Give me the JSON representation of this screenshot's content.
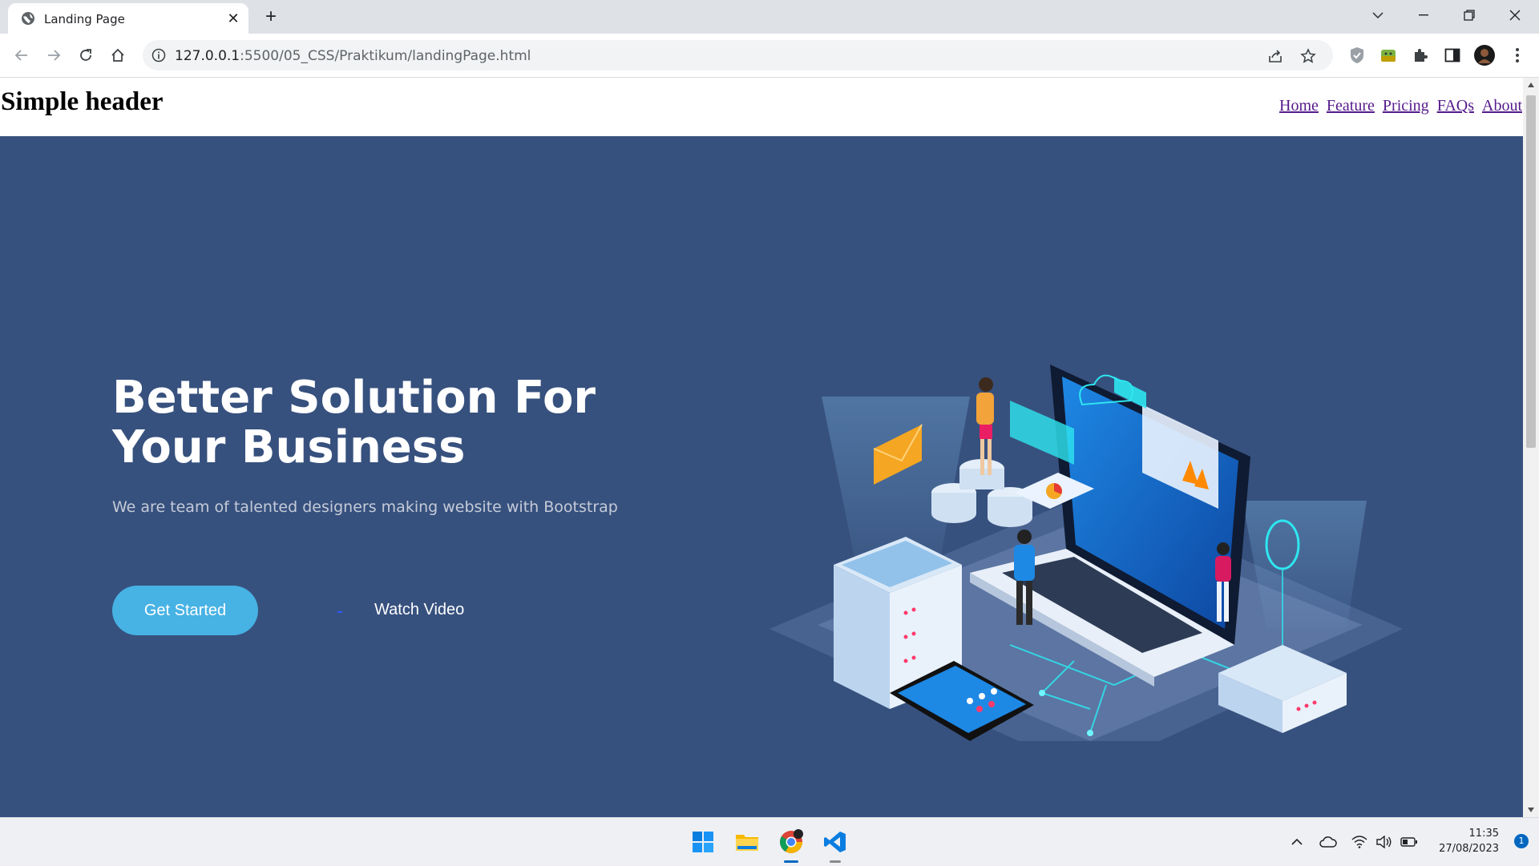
{
  "browser": {
    "tab_title": "Landing Page",
    "url_host": "127.0.0.1",
    "url_rest": ":5500/05_CSS/Praktikum/landingPage.html"
  },
  "site": {
    "header_title": "Simple header",
    "nav": [
      "Home",
      "Feature",
      "Pricing",
      "FAQs",
      "About"
    ]
  },
  "hero": {
    "headline": "Better Solution For Your Business",
    "subtitle": "We are team of talented designers making website with Bootstrap",
    "primary_button": "Get Started",
    "secondary_button": "Watch Video",
    "background_color": "#37517e",
    "accent_color": "#47b2e4"
  },
  "taskbar": {
    "time": "11:35",
    "date": "27/08/2023",
    "notification_count": "1",
    "apps": [
      "start-icon",
      "file-explorer-icon",
      "chrome-icon",
      "vscode-icon"
    ]
  }
}
